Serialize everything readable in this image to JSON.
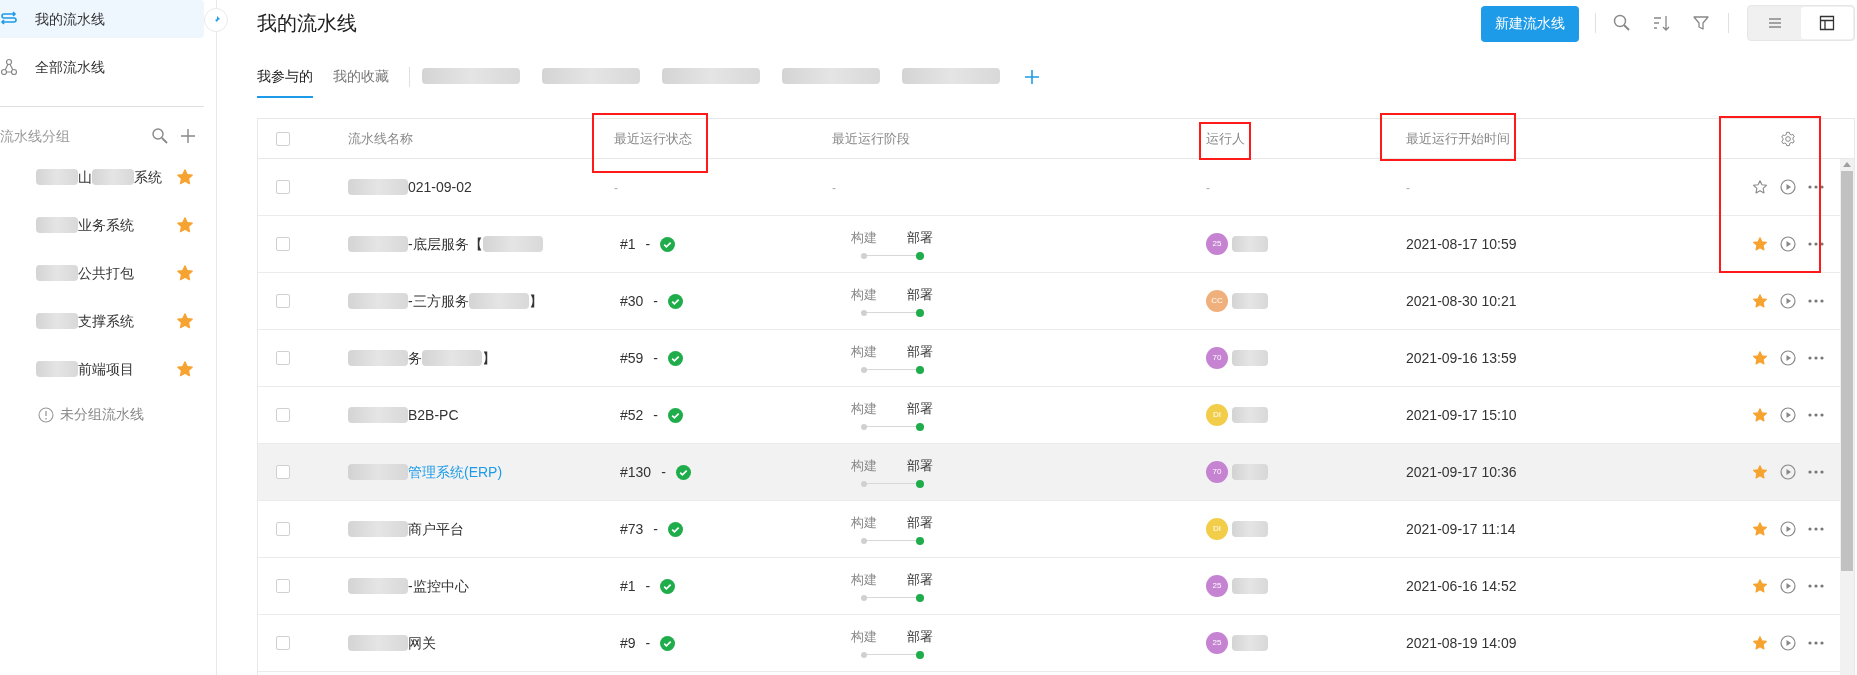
{
  "sidebar": {
    "nav": [
      {
        "label": "我的流水线",
        "selected": true
      },
      {
        "label": "全部流水线",
        "selected": false
      }
    ],
    "groups_header": "流水线分组",
    "groups": [
      {
        "parts": [
          {
            "kind": "blur"
          },
          {
            "kind": "text",
            "text": "山"
          },
          {
            "kind": "blur"
          },
          {
            "kind": "text",
            "text": "系统"
          }
        ],
        "starred": true
      },
      {
        "parts": [
          {
            "kind": "blur"
          },
          {
            "kind": "text",
            "text": "业务系统"
          }
        ],
        "starred": true
      },
      {
        "parts": [
          {
            "kind": "blur"
          },
          {
            "kind": "text",
            "text": "公共打包"
          }
        ],
        "starred": true
      },
      {
        "parts": [
          {
            "kind": "blur"
          },
          {
            "kind": "text",
            "text": "支撑系统"
          }
        ],
        "starred": true
      },
      {
        "parts": [
          {
            "kind": "blur"
          },
          {
            "kind": "text",
            "text": "前端项目"
          }
        ],
        "starred": true
      }
    ],
    "ungrouped": "未分组流水线"
  },
  "header": {
    "title": "我的流水线",
    "new_button": "新建流水线",
    "view_modes": [
      {
        "kind": "list",
        "selected": false
      },
      {
        "kind": "board",
        "selected": true
      }
    ]
  },
  "tabs": [
    {
      "kind": "text",
      "label": "我参与的",
      "selected": true
    },
    {
      "kind": "text",
      "label": "我的收藏",
      "selected": false
    },
    {
      "kind": "blur",
      "selected": false
    },
    {
      "kind": "blur",
      "selected": false
    },
    {
      "kind": "blur",
      "selected": false
    },
    {
      "kind": "blur",
      "selected": false
    },
    {
      "kind": "blur",
      "selected": false
    }
  ],
  "table": {
    "header_checked": false,
    "columns": [
      {
        "kind": "name",
        "label": "流水线名称",
        "highlighted": false
      },
      {
        "kind": "status",
        "label": "最近运行状态",
        "highlighted": true
      },
      {
        "kind": "stage",
        "label": "最近运行阶段",
        "highlighted": false
      },
      {
        "kind": "runner",
        "label": "运行人",
        "highlighted": true
      },
      {
        "kind": "time",
        "label": "最近运行开始时间",
        "highlighted": true
      },
      {
        "kind": "actions",
        "highlighted": true
      }
    ],
    "rows": [
      {
        "kind": "empty",
        "checked": false,
        "hovered": false,
        "annotated": true,
        "starred": false,
        "link": false,
        "name": [
          {
            "kind": "blur"
          },
          {
            "kind": "text",
            "text": "021-09-02"
          }
        ],
        "status": "-",
        "stage": "-",
        "runner": "-",
        "time": "-"
      },
      {
        "kind": "run",
        "checked": false,
        "hovered": false,
        "annotated": true,
        "starred": true,
        "link": false,
        "name": [
          {
            "kind": "blur"
          },
          {
            "kind": "text",
            "text": "-底层服务【"
          },
          {
            "kind": "blur"
          }
        ],
        "run": "#1",
        "sep": "-",
        "passed": true,
        "stages": [
          {
            "label": "构建",
            "active": false
          },
          {
            "label": "部署",
            "active": true
          }
        ],
        "avatar": "25",
        "color": "#c583d2",
        "time": "2021-08-17 10:59"
      },
      {
        "kind": "run",
        "checked": false,
        "hovered": false,
        "annotated": false,
        "starred": true,
        "link": false,
        "name": [
          {
            "kind": "blur"
          },
          {
            "kind": "text",
            "text": "-三方服务"
          },
          {
            "kind": "blur"
          },
          {
            "kind": "text",
            "text": "】"
          }
        ],
        "run": "#30",
        "sep": "-",
        "passed": true,
        "stages": [
          {
            "label": "构建",
            "active": false
          },
          {
            "label": "部署",
            "active": true
          }
        ],
        "avatar": "CC",
        "color": "#f0b07c",
        "time": "2021-08-30 10:21"
      },
      {
        "kind": "run",
        "checked": false,
        "hovered": false,
        "annotated": false,
        "starred": true,
        "link": false,
        "name": [
          {
            "kind": "blur"
          },
          {
            "kind": "text",
            "text": "务"
          },
          {
            "kind": "blur"
          },
          {
            "kind": "text",
            "text": "】"
          }
        ],
        "run": "#59",
        "sep": "-",
        "passed": true,
        "stages": [
          {
            "label": "构建",
            "active": false
          },
          {
            "label": "部署",
            "active": true
          }
        ],
        "avatar": "70",
        "color": "#c583d2",
        "time": "2021-09-16 13:59"
      },
      {
        "kind": "run",
        "checked": false,
        "hovered": false,
        "annotated": false,
        "starred": true,
        "link": false,
        "name": [
          {
            "kind": "blur"
          },
          {
            "kind": "text",
            "text": "B2B-PC"
          }
        ],
        "run": "#52",
        "sep": "-",
        "passed": true,
        "stages": [
          {
            "label": "构建",
            "active": false
          },
          {
            "label": "部署",
            "active": true
          }
        ],
        "avatar": "DI",
        "color": "#f2cd4a",
        "time": "2021-09-17 15:10"
      },
      {
        "kind": "run",
        "checked": false,
        "hovered": true,
        "annotated": false,
        "starred": true,
        "link": true,
        "name": [
          {
            "kind": "blur"
          },
          {
            "kind": "text",
            "text": "管理系统(ERP)"
          }
        ],
        "run": "#130",
        "sep": "-",
        "passed": true,
        "stages": [
          {
            "label": "构建",
            "active": false
          },
          {
            "label": "部署",
            "active": true
          }
        ],
        "avatar": "70",
        "color": "#c583d2",
        "time": "2021-09-17 10:36"
      },
      {
        "kind": "run",
        "checked": false,
        "hovered": false,
        "annotated": false,
        "starred": true,
        "link": false,
        "name": [
          {
            "kind": "blur"
          },
          {
            "kind": "text",
            "text": "商户平台"
          }
        ],
        "run": "#73",
        "sep": "-",
        "passed": true,
        "stages": [
          {
            "label": "构建",
            "active": false
          },
          {
            "label": "部署",
            "active": true
          }
        ],
        "avatar": "DI",
        "color": "#f2cd4a",
        "time": "2021-09-17 11:14"
      },
      {
        "kind": "run",
        "checked": false,
        "hovered": false,
        "annotated": false,
        "starred": true,
        "link": false,
        "name": [
          {
            "kind": "blur"
          },
          {
            "kind": "text",
            "text": "-监控中心"
          }
        ],
        "run": "#1",
        "sep": "-",
        "passed": true,
        "stages": [
          {
            "label": "构建",
            "active": false
          },
          {
            "label": "部署",
            "active": true
          }
        ],
        "avatar": "25",
        "color": "#c583d2",
        "time": "2021-06-16 14:52"
      },
      {
        "kind": "run",
        "checked": false,
        "hovered": false,
        "annotated": false,
        "starred": true,
        "link": false,
        "name": [
          {
            "kind": "blur"
          },
          {
            "kind": "text",
            "text": "网关"
          }
        ],
        "run": "#9",
        "sep": "-",
        "passed": true,
        "stages": [
          {
            "label": "构建",
            "active": false
          },
          {
            "label": "部署",
            "active": true
          }
        ],
        "avatar": "25",
        "color": "#c583d2",
        "time": "2021-08-19 14:09"
      }
    ]
  }
}
